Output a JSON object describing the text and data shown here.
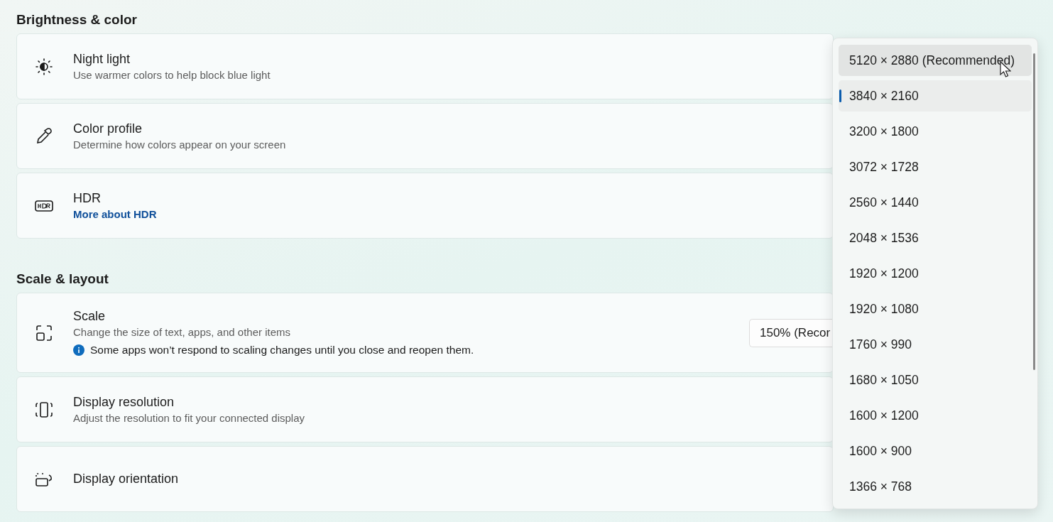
{
  "sections": [
    {
      "heading": "Brightness & color",
      "cards": [
        {
          "kind": "subtitle",
          "title": "Night light",
          "subtitle": "Use warmer colors to help block blue light"
        },
        {
          "kind": "subtitle",
          "title": "Color profile",
          "subtitle": "Determine how colors appear on your screen"
        },
        {
          "kind": "link",
          "title": "HDR",
          "link": "More about HDR"
        }
      ]
    },
    {
      "heading": "Scale & layout",
      "cards": [
        {
          "kind": "info",
          "title": "Scale",
          "subtitle": "Change the size of text, apps, and other items",
          "info": "Some apps won’t respond to scaling changes until you close and reopen them.",
          "combo_value": "150% (Recor"
        },
        {
          "kind": "subtitle",
          "title": "Display resolution",
          "subtitle": "Adjust the resolution to fit your connected display"
        },
        {
          "kind": "plain",
          "title": "Display orientation"
        }
      ]
    }
  ],
  "dropdown": {
    "items": [
      {
        "label": "5120 × 2880 (Recommended)",
        "selected": false,
        "hovered": true
      },
      {
        "label": "3840 × 2160",
        "selected": true,
        "hovered": false
      },
      {
        "label": "3200 × 1800",
        "selected": false,
        "hovered": false
      },
      {
        "label": "3072 × 1728",
        "selected": false,
        "hovered": false
      },
      {
        "label": "2560 × 1440",
        "selected": false,
        "hovered": false
      },
      {
        "label": "2048 × 1536",
        "selected": false,
        "hovered": false
      },
      {
        "label": "1920 × 1200",
        "selected": false,
        "hovered": false
      },
      {
        "label": "1920 × 1080",
        "selected": false,
        "hovered": false
      },
      {
        "label": "1760 × 990",
        "selected": false,
        "hovered": false
      },
      {
        "label": "1680 × 1050",
        "selected": false,
        "hovered": false
      },
      {
        "label": "1600 × 1200",
        "selected": false,
        "hovered": false
      },
      {
        "label": "1600 × 900",
        "selected": false,
        "hovered": false
      },
      {
        "label": "1366 × 768",
        "selected": false,
        "hovered": false
      }
    ]
  }
}
